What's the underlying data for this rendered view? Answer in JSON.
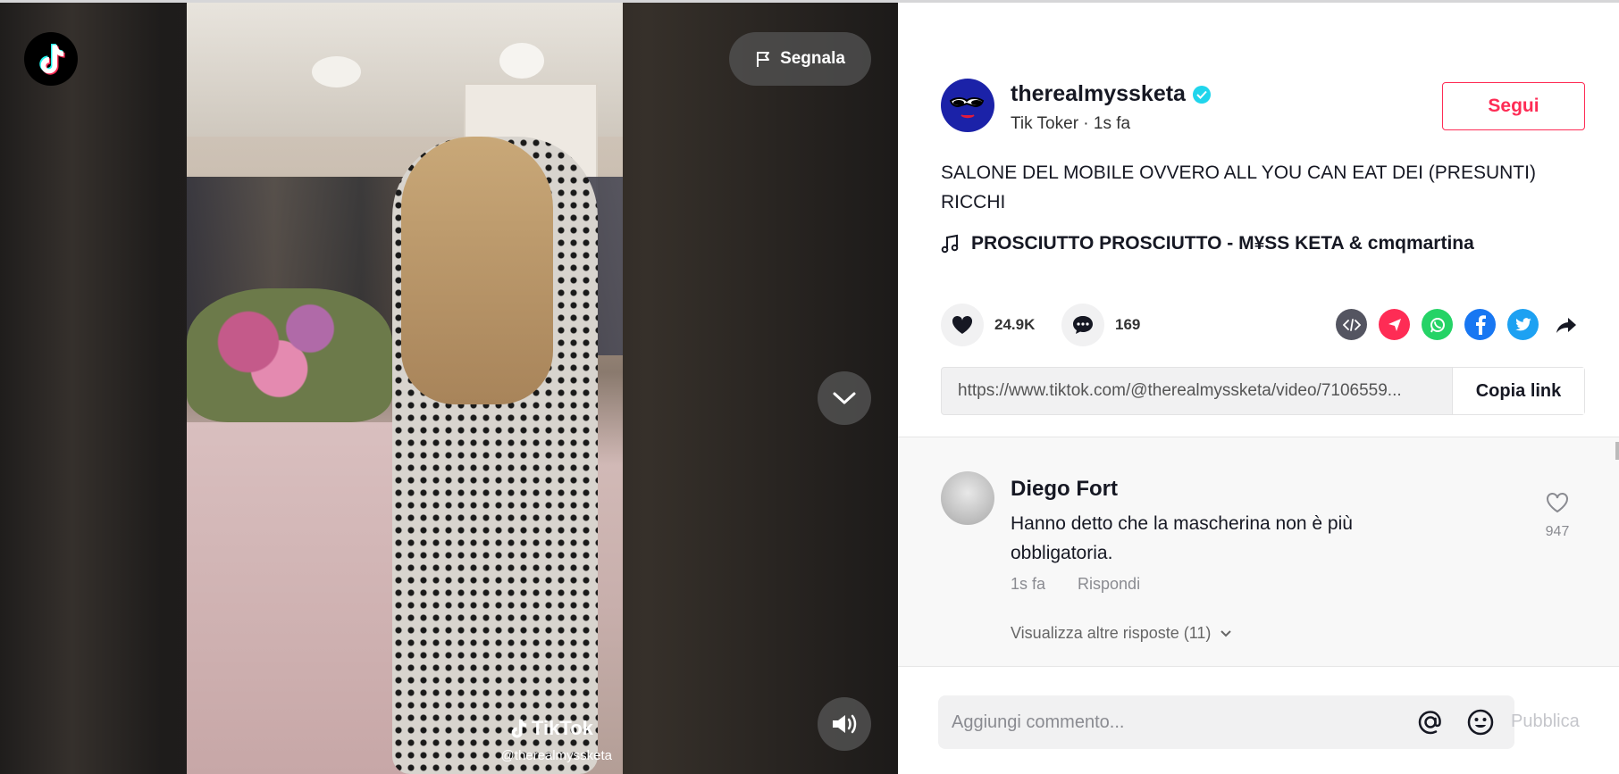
{
  "video": {
    "report_label": "Segnala",
    "watermark_brand": "TikTok",
    "watermark_user": "@therealmyssketa"
  },
  "author": {
    "username": "therealmyssketa",
    "subtitle": "Tik Toker · 1s fa",
    "follow_label": "Segui"
  },
  "post": {
    "caption": "SALONE DEL MOBILE OVVERO ALL YOU CAN EAT DEI (PRESUNTI) RICCHI",
    "music": "PROSCIUTTO PROSCIUTTO - M¥SS KETA & cmqmartina",
    "likes": "24.9K",
    "comments": "169"
  },
  "share": {
    "link": "https://www.tiktok.com/@therealmyssketa/video/7106559...",
    "copy_label": "Copia link",
    "icons": [
      "embed-icon",
      "send-icon",
      "whatsapp-icon",
      "facebook-icon",
      "twitter-icon",
      "share-arrow-icon"
    ]
  },
  "comment": {
    "author": "Diego Fort",
    "text": "Hanno detto che la mascherina non è più obbligatoria.",
    "time": "1s fa",
    "reply_label": "Rispondi",
    "view_replies": "Visualizza altre risposte (11)",
    "likes": "947"
  },
  "composer": {
    "placeholder": "Aggiungi commento...",
    "publish_label": "Pubblica"
  },
  "colors": {
    "accent": "#fe2c55",
    "verified": "#20d5ec",
    "whatsapp": "#25d366",
    "facebook": "#1877f2",
    "twitter": "#1da1f2"
  }
}
